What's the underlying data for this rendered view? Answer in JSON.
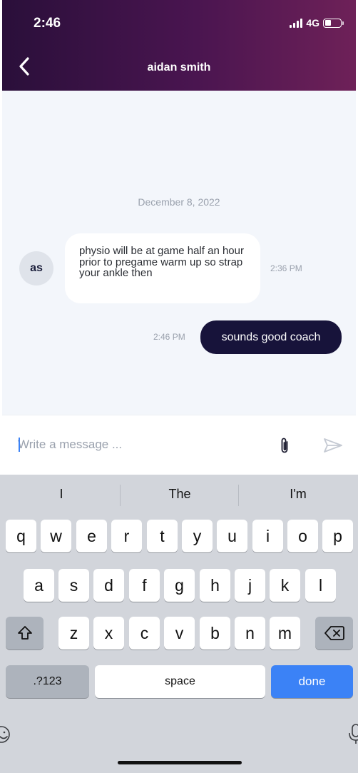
{
  "status_bar": {
    "time": "2:46",
    "network": "4G"
  },
  "header": {
    "title": "aidan smith"
  },
  "chat": {
    "date": "December 8, 2022",
    "incoming": {
      "avatar": "as",
      "text": "physio will be at game half an hour prior to pregame warm up so strap your ankle then",
      "time": "2:36 PM"
    },
    "outgoing": {
      "text": "sounds good coach",
      "time": "2:46 PM"
    }
  },
  "composer": {
    "placeholder": "Write a message ..."
  },
  "keyboard": {
    "suggestions": [
      "I",
      "The",
      "I'm"
    ],
    "row1": [
      "q",
      "w",
      "e",
      "r",
      "t",
      "y",
      "u",
      "i",
      "o",
      "p"
    ],
    "row2": [
      "a",
      "s",
      "d",
      "f",
      "g",
      "h",
      "j",
      "k",
      "l"
    ],
    "row3": [
      "z",
      "x",
      "c",
      "v",
      "b",
      "n",
      "m"
    ],
    "numbers_key": ".?123",
    "space_key": "space",
    "done_key": "done"
  },
  "colors": {
    "header_start": "#2a0f3a",
    "header_end": "#6e2158",
    "outgoing_bubble": "#17133a",
    "accent": "#3b82f6"
  }
}
